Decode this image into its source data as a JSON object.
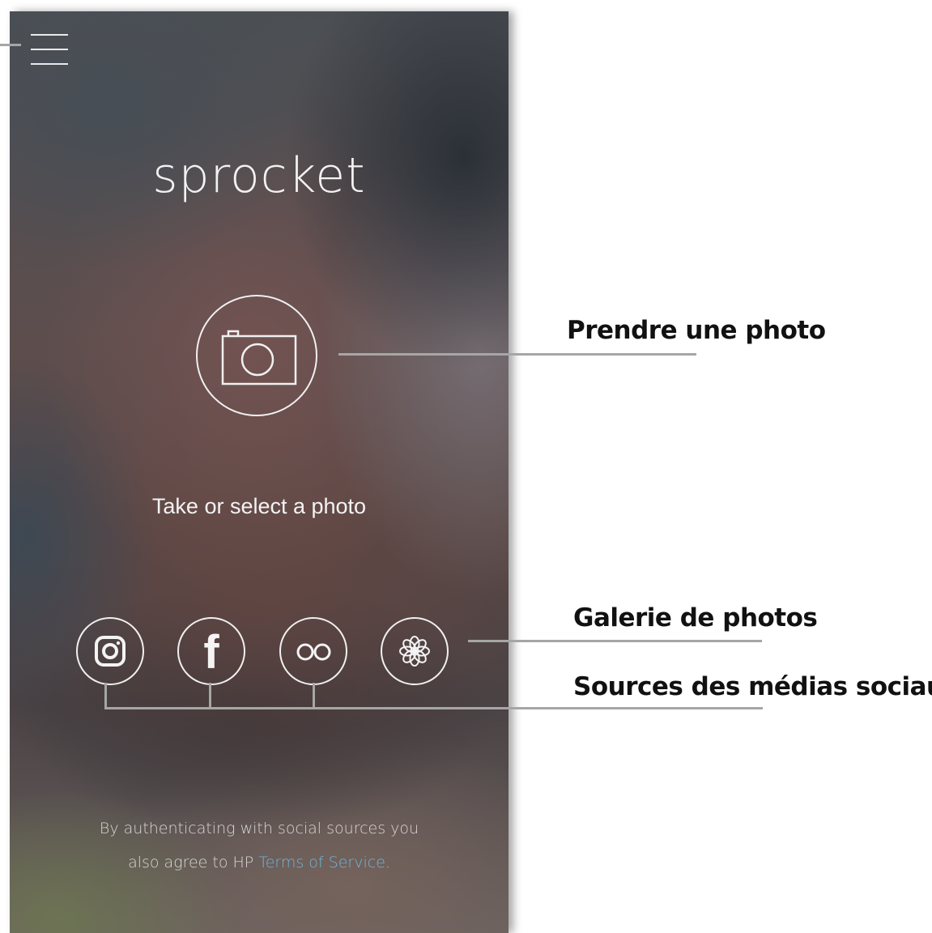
{
  "app": {
    "title": "sprocket"
  },
  "main": {
    "camera_icon": "camera-icon",
    "prompt": "Take or select a photo"
  },
  "social_sources": [
    {
      "name": "instagram",
      "icon": "instagram-icon"
    },
    {
      "name": "facebook",
      "icon": "facebook-icon",
      "glyph": "f"
    },
    {
      "name": "flickr",
      "icon": "flickr-icon"
    },
    {
      "name": "photo-gallery",
      "icon": "flower-icon"
    }
  ],
  "legal": {
    "line1": "By authenticating with social sources you",
    "line2_prefix": "also agree to HP ",
    "terms_link": "Terms of Service",
    "line2_suffix": "."
  },
  "annotations": {
    "take_photo": "Prendre une photo",
    "photo_gallery": "Galerie de photos",
    "social_sources": "Sources des médias sociaux"
  },
  "colors": {
    "link": "#6fb4d8",
    "annotation_line": "#a6a6a6",
    "annotation_text": "#111111",
    "icon_stroke": "#f0f0f0"
  }
}
